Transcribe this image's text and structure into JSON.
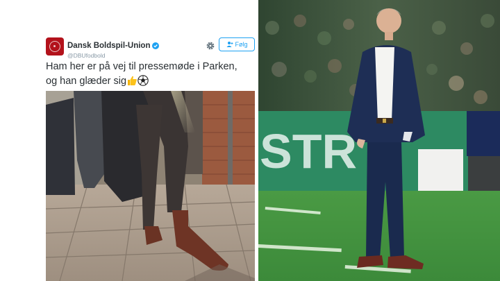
{
  "tweet": {
    "display_name": "Dansk Boldspil-Union",
    "handle": "@DBUfodbold",
    "follow_label": "Følg",
    "text_line1": "Ham her er på vej til pressemøde i Parken,",
    "text_line2": "og han glæder sig",
    "verified_icon": "verified-badge-icon",
    "gear_icon": "gear-icon",
    "follow_icon": "person-plus-icon",
    "accent_color": "#1da1f2",
    "avatar_color": "#b3121b"
  },
  "right_photo": {
    "board_text": "STR"
  }
}
